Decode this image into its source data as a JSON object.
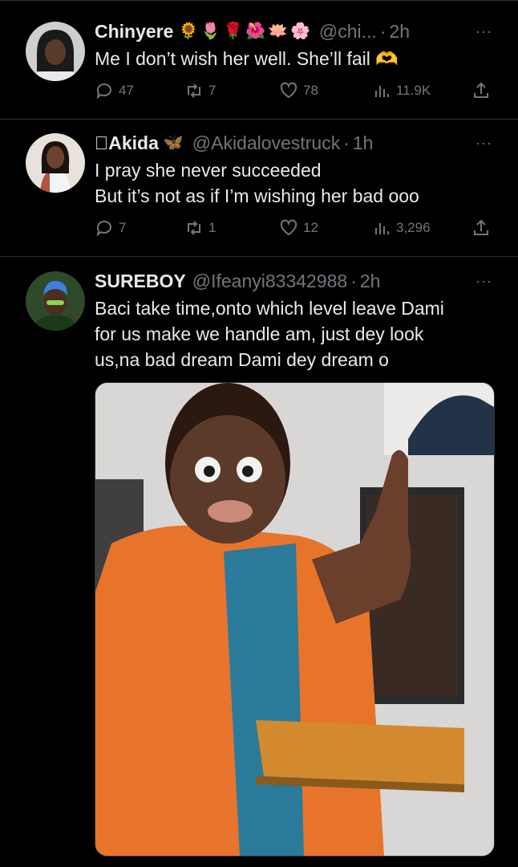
{
  "tweets": [
    {
      "name": "Chinyere",
      "name_emoji": "🌻🌷🌹🌺🪷🌸",
      "handle": "@chi...",
      "time": "2h",
      "text_lines": [
        "Me I don’t wish her well. She’ll fail 🫶"
      ],
      "replies": "47",
      "retweets": "7",
      "likes": "78",
      "views": "11.9K"
    },
    {
      "name": "Akida",
      "name_prefix": "",
      "name_emoji": "🦋",
      "handle": "@Akidalovestruck",
      "time": "1h",
      "text_lines": [
        "I pray she never succeeded",
        "But it’s not as if I’m wishing her bad ooo"
      ],
      "replies": "7",
      "retweets": "1",
      "likes": "12",
      "views": "3,296"
    },
    {
      "name": "SUREBOY",
      "handle": "@Ifeanyi83342988",
      "time": "2h",
      "text_lines": [
        "Baci take time,onto which level leave Dami",
        "for us make we handle am, just dey look",
        "us,na bad dream Dami dey dream o"
      ]
    }
  ],
  "separator": "·",
  "more_glyph": "···",
  "colors": {
    "background": "#000000",
    "text": "#e7e9ea",
    "secondary": "#71767b",
    "divider": "#2f3336"
  },
  "icons": [
    "reply-icon",
    "retweet-icon",
    "like-icon",
    "views-icon",
    "share-icon",
    "more-icon"
  ]
}
